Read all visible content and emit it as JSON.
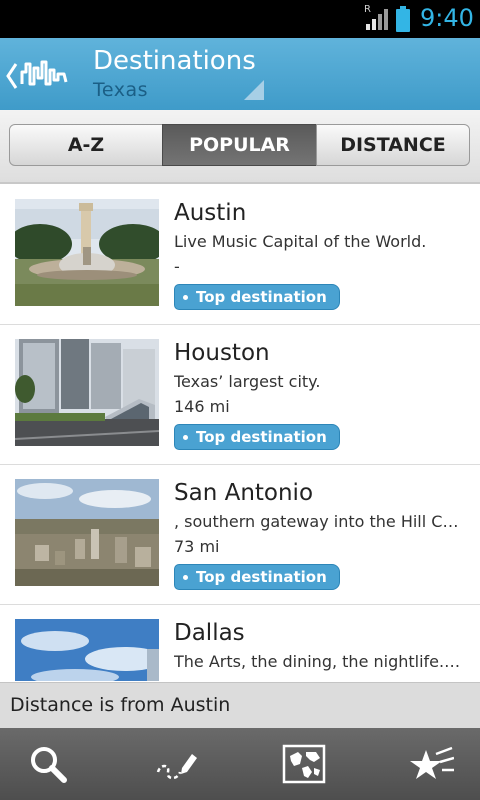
{
  "status_bar": {
    "time": "9:40",
    "roaming_indicator": "R",
    "icons": [
      "signal-icon",
      "battery-icon"
    ],
    "accent_color": "#33b5e5"
  },
  "header": {
    "title": "Destinations",
    "subtitle": "Texas",
    "icons": [
      "back-chevron-icon",
      "city-skyline-logo-icon",
      "dropdown-corner-icon"
    ]
  },
  "sort_tabs": [
    {
      "label": "A-Z",
      "selected": false
    },
    {
      "label": "POPULAR",
      "selected": true
    },
    {
      "label": "DISTANCE",
      "selected": false
    }
  ],
  "destinations": [
    {
      "name": "Austin",
      "description": "Live Music Capital of the World.",
      "distance": "-",
      "badge": "Top destination",
      "thumbnail": "fountain-and-tower-photo"
    },
    {
      "name": "Houston",
      "description": "Texas’ largest city.",
      "distance": "146 mi",
      "badge": "Top destination",
      "thumbnail": "light-rail-downtown-photo"
    },
    {
      "name": "San Antonio",
      "description": ", southern gateway into the Hill Co...",
      "distance": "73 mi",
      "badge": "Top destination",
      "thumbnail": "city-skyline-aerial-photo"
    },
    {
      "name": "Dallas",
      "description": "The Arts, the dining, the nightlife... ...",
      "distance": "",
      "badge": "",
      "thumbnail": "blue-sky-clouds-photo"
    }
  ],
  "footer_note": "Distance is from Austin",
  "toolbar": {
    "icons": [
      "search-icon",
      "draw-route-icon",
      "world-map-icon",
      "favorite-stars-icon"
    ]
  },
  "colors": {
    "header_blue": "#4aa5d2",
    "badge_blue": "#4aa2d2",
    "selected_tab": "#646464"
  }
}
